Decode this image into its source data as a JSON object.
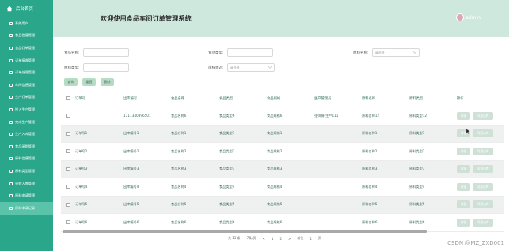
{
  "sidebar": {
    "home_label": "后台首页",
    "items": [
      {
        "label": "系统用户"
      },
      {
        "label": "食品信息管理"
      },
      {
        "label": "食品订单管理"
      },
      {
        "label": "订单接收管理"
      },
      {
        "label": "订单处理管理"
      },
      {
        "label": "车间信息管理"
      },
      {
        "label": "生产订单管理"
      },
      {
        "label": "投入生产管理"
      },
      {
        "label": "完成生产管理"
      },
      {
        "label": "生产入库管理"
      },
      {
        "label": "食品采购管理"
      },
      {
        "label": "原料信息管理"
      },
      {
        "label": "原料类型管理"
      },
      {
        "label": "采购入库管理"
      },
      {
        "label": "原料申请管理"
      },
      {
        "label": "原料申请记录"
      }
    ],
    "active_index": 15
  },
  "header": {
    "title": "欢迎使用食品车间订单管理系统",
    "username": "admin"
  },
  "search": {
    "food_name_label": "食品名称:",
    "food_type_label": "食品类型:",
    "material_name_label": "原料名称:",
    "material_name_placeholder": "请选择",
    "material_type_label": "原料类型:",
    "audit_status_label": "审核状态:",
    "audit_status_placeholder": "请选择",
    "query_btn": "查询",
    "reset_btn": "重置",
    "delete_btn": "删除"
  },
  "table": {
    "headers": [
      "订单号",
      "出库编号",
      "食品名称",
      "食品类型",
      "食品规格",
      "生产管理员",
      "原料名称",
      "原料类型",
      "操作"
    ],
    "rows": [
      {
        "order": "",
        "out": "1711340396501",
        "name": "食品名称6",
        "type": "食品类型6",
        "spec": "食品规格6",
        "admin": "张师傅-生产111",
        "mname": "原料名称12",
        "mtype": "原料类型12"
      },
      {
        "order": "订单号1",
        "out": "出库编号1",
        "name": "食品名称1",
        "type": "食品类型1",
        "spec": "食品规格1",
        "admin": "",
        "mname": "原料名称1",
        "mtype": "原料类型1"
      },
      {
        "order": "订单号2",
        "out": "出库编号2",
        "name": "食品名称2",
        "type": "食品类型2",
        "spec": "食品规格2",
        "admin": "",
        "mname": "原料名称2",
        "mtype": "原料类型2"
      },
      {
        "order": "订单号3",
        "out": "出库编号3",
        "name": "食品名称3",
        "type": "食品类型3",
        "spec": "食品规格3",
        "admin": "",
        "mname": "原料名称3",
        "mtype": "原料类型3"
      },
      {
        "order": "订单号4",
        "out": "出库编号4",
        "name": "食品名称4",
        "type": "食品类型4",
        "spec": "食品规格4",
        "admin": "",
        "mname": "原料名称4",
        "mtype": "原料类型4"
      },
      {
        "order": "订单号5",
        "out": "出库编号5",
        "name": "食品名称5",
        "type": "食品类型5",
        "spec": "食品规格5",
        "admin": "",
        "mname": "原料名称5",
        "mtype": "原料类型5"
      },
      {
        "order": "订单号6",
        "out": "出库编号6",
        "name": "食品名称6",
        "type": "食品类型6",
        "spec": "食品规格6",
        "admin": "",
        "mname": "原料名称6",
        "mtype": "原料类型6"
      }
    ],
    "detail_btn": "详情",
    "remark_btn": "同意出库"
  },
  "pager": {
    "total": "共 13 条",
    "page_size": "7条/页",
    "prev": "<",
    "page1": "1",
    "page2": "2",
    "next": ">",
    "goto": "前往",
    "page_input": "1",
    "page_unit": "页"
  },
  "watermark": "CSDN @MZ_ZXD001"
}
